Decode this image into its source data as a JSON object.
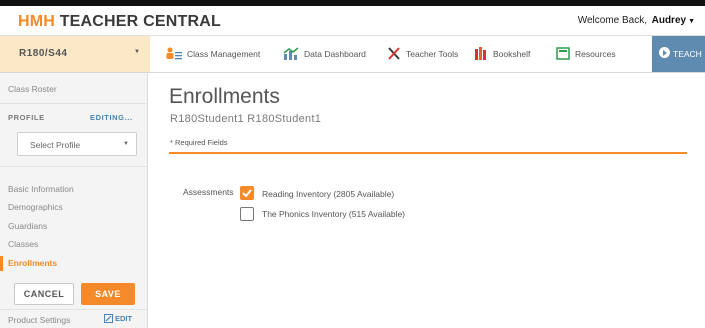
{
  "header": {
    "brand_hmh": "HMH",
    "brand_rest": "TEACHER CENTRAL",
    "welcome": "Welcome Back,",
    "user": "Audrey"
  },
  "nav": {
    "class_selector": "R180/S44",
    "items": [
      {
        "label": "Class Management",
        "icon": "class-management-icon"
      },
      {
        "label": "Data Dashboard",
        "icon": "chart-icon"
      },
      {
        "label": "Teacher Tools",
        "icon": "tools-icon"
      },
      {
        "label": "Bookshelf",
        "icon": "bookshelf-icon"
      },
      {
        "label": "Resources",
        "icon": "resources-icon"
      }
    ],
    "teach_label": "TEACH"
  },
  "sidebar": {
    "class_roster": "Class Roster",
    "profile": "PROFILE",
    "editing": "EDITING...",
    "select_profile": "Select Profile",
    "links": [
      "Basic Information",
      "Demographics",
      "Guardians",
      "Classes",
      "Enrollments"
    ],
    "active_link": "Enrollments",
    "cancel": "CANCEL",
    "save": "SAVE",
    "product_settings": "Product Settings",
    "edit": "EDIT"
  },
  "main": {
    "title": "Enrollments",
    "student_name": "R180Student1 R180Student1",
    "required_note": "* Required Fields",
    "assessments_label": "Assessments",
    "assessments": [
      {
        "label": "Reading Inventory (2805 Available)",
        "checked": true
      },
      {
        "label": "The Phonics Inventory (515 Available)",
        "checked": false
      }
    ]
  },
  "colors": {
    "accent": "#f48a2a",
    "link": "#4c82b4",
    "teach": "#5f8bb0",
    "class_selector_bg": "#fbe8c6"
  }
}
